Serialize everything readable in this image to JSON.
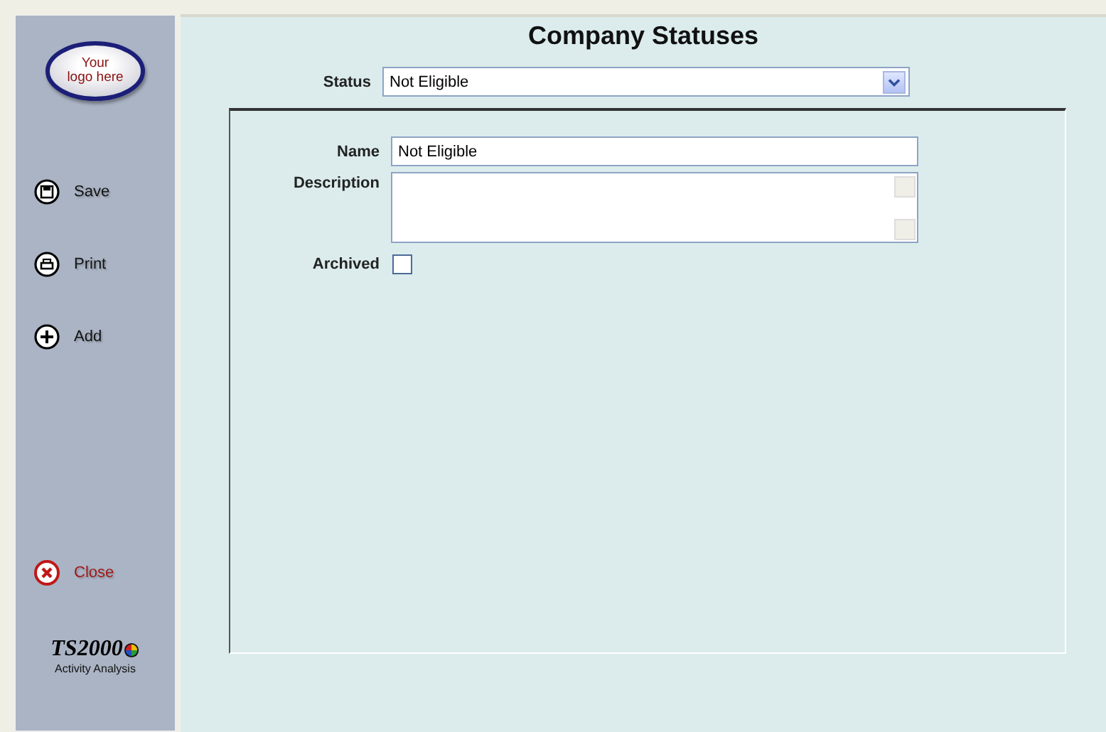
{
  "sidebar": {
    "logo": {
      "line1": "Your",
      "line2": "logo here"
    },
    "actions": [
      {
        "kind": "save",
        "label": "Save"
      },
      {
        "kind": "print",
        "label": "Print"
      },
      {
        "kind": "add",
        "label": "Add"
      }
    ],
    "close": {
      "label": "Close"
    },
    "brand": {
      "name": "TS2000",
      "tagline": "Activity Analysis"
    }
  },
  "title": "Company Statuses",
  "status": {
    "label": "Status",
    "value": "Not Eligible"
  },
  "form": {
    "name": {
      "label": "Name",
      "value": "Not Eligible"
    },
    "description": {
      "label": "Description"
    },
    "archived": {
      "label": "Archived",
      "checked": false
    }
  }
}
